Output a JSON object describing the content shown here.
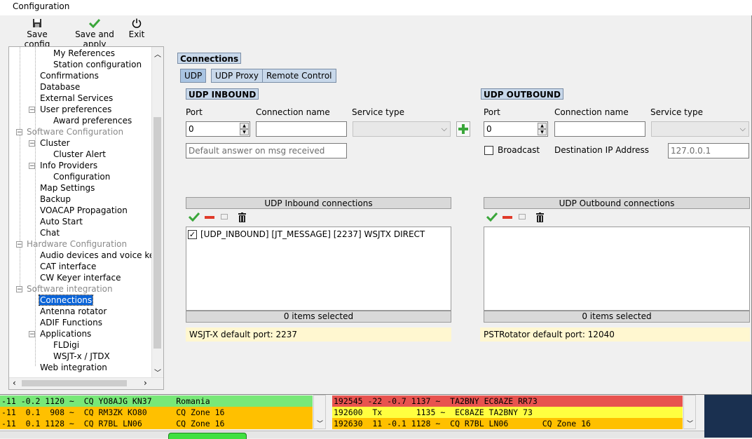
{
  "window": {
    "title": "Configuration"
  },
  "toolbar": {
    "save_config": "Save config",
    "save_apply": "Save and apply",
    "exit": "Exit"
  },
  "tree": {
    "items": [
      "My References",
      "Station configuration",
      "Confirmations",
      "Database",
      "External Services",
      "User preferences",
      "Award preferences",
      "Software Configuration",
      "Cluster",
      "Cluster Alert",
      "Info Providers",
      "Configuration",
      "Map Settings",
      "Backup",
      "VOACAP Propagation",
      "Auto Start",
      "Chat",
      "Hardware Configuration",
      "Audio devices and voice keye",
      "CAT interface",
      "CW Keyer interface",
      "Software integration",
      "Connections",
      "Antenna rotator",
      "ADIF Functions",
      "Applications",
      "FLDigi",
      "WSJT-x / JTDX",
      "Web integration"
    ],
    "selected": "Connections"
  },
  "main": {
    "section_title": "Connections",
    "tabs": [
      "UDP",
      "UDP Proxy",
      "Remote Control"
    ],
    "active_tab": "UDP"
  },
  "inbound": {
    "title": "UDP INBOUND",
    "port_label": "Port",
    "port_value": "0",
    "conn_name_label": "Connection name",
    "conn_name_value": "",
    "service_type_label": "Service type",
    "service_type_value": "",
    "default_answer_placeholder": "Default answer on msg received",
    "list_title": "UDP Inbound connections",
    "items": [
      "[UDP_INBOUND] [JT_MESSAGE] [2237] WSJTX DIRECT"
    ],
    "footer": "0 items selected",
    "hint": "WSJT-X default port: 2237"
  },
  "outbound": {
    "title": "UDP OUTBOUND",
    "port_label": "Port",
    "port_value": "0",
    "conn_name_label": "Connection name",
    "conn_name_value": "",
    "service_type_label": "Service type",
    "broadcast_label": "Broadcast",
    "dest_ip_label": "Destination IP Address",
    "dest_ip_value": "127.0.0.1",
    "list_title": "UDP Outbound connections",
    "footer": "0 items selected",
    "hint": "PSTRotator default port: 12040"
  },
  "background": {
    "left_rows": [
      "-11 -0.2 1120 ~  CQ YO8AJG KN37     Romania",
      "-11  0.1  908 ~  CQ RM3ZK KO80      CQ Zone 16",
      "-11  0.1 1128 ~  CQ R7BL LN06       CQ Zone 16"
    ],
    "right_rows": [
      "192545 -22 -0.7 1137 ~  TA2BNY EC8AZE RR73",
      "192600  Tx       1135 ~  EC8AZE TA2BNY 73",
      "192630  11 -0.1 1128 ~  CQ R7BL LN06       CQ Zone 16"
    ]
  },
  "colors": {
    "accent": "#0a64d8",
    "row_green": "#78e878",
    "row_orange": "#ffc000",
    "row_red": "#e8534f",
    "row_yellow": "#ffff40",
    "tag_bg": "#c8d8ea",
    "hint_bg": "#fff7d0"
  }
}
